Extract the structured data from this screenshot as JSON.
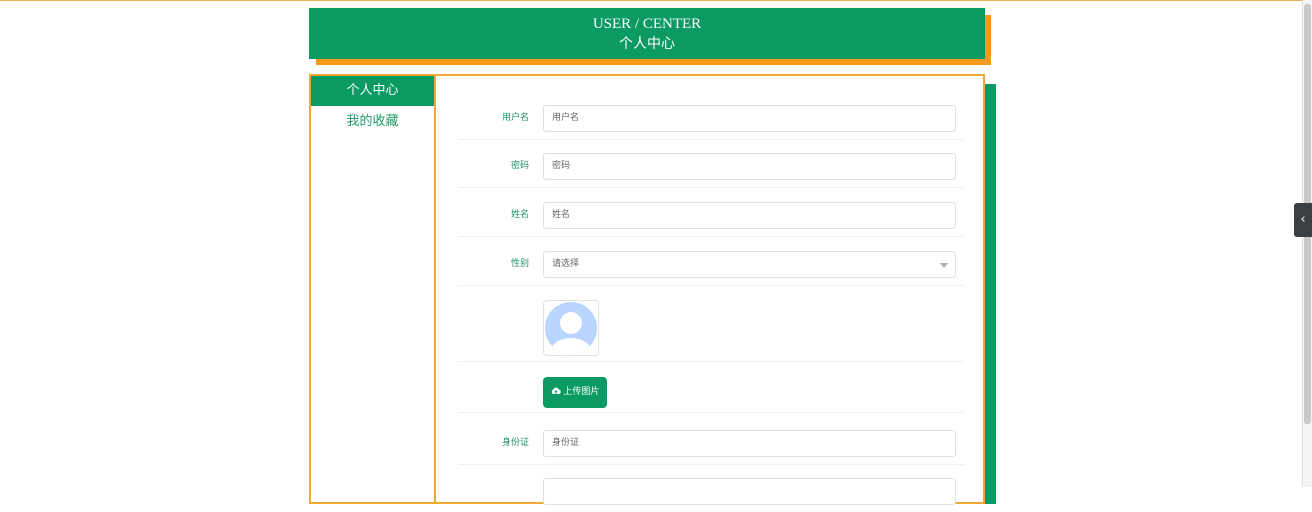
{
  "header": {
    "title_en": "USER / CENTER",
    "title_cn": "个人中心"
  },
  "sidebar": {
    "items": [
      {
        "label": "个人中心"
      },
      {
        "label": "我的收藏"
      }
    ]
  },
  "form": {
    "fields": [
      {
        "label": "用户名",
        "placeholder": "用户名"
      },
      {
        "label": "密码",
        "placeholder": "密码"
      },
      {
        "label": "姓名",
        "placeholder": "姓名"
      },
      {
        "label": "性别",
        "placeholder": "请选择"
      },
      {
        "label": "身份证",
        "placeholder": "身份证"
      },
      {
        "label": "",
        "placeholder": ""
      }
    ],
    "upload_label": "上传图片"
  },
  "colors": {
    "primary": "#0a9a62",
    "accent": "#f59a16",
    "border": "#f0a734",
    "avatar": "#b8d4ff"
  },
  "icons": {
    "avatar": "user-avatar-icon",
    "upload": "cloud-upload-icon",
    "toggle": "chevron-left-icon",
    "select": "caret-down-icon"
  }
}
